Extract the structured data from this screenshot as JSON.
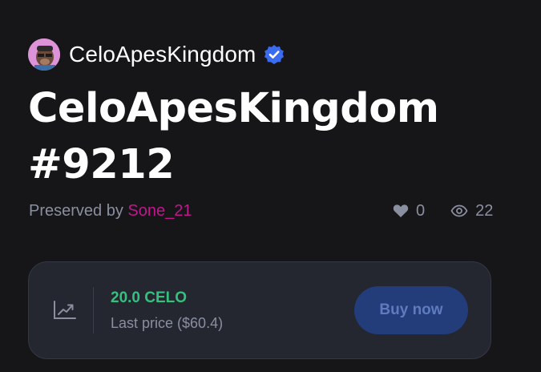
{
  "collection": {
    "name": "CeloApesKingdom",
    "verified_icon": "verified-badge-icon",
    "verified_color": "#3b6cf0"
  },
  "nft": {
    "title_line1": "CeloApesKingdom",
    "title_line2": "#9212"
  },
  "owner": {
    "prefix": "Preserved by",
    "name": "Sone_21",
    "name_color": "#c0178d"
  },
  "stats": {
    "likes": "0",
    "views": "22",
    "likes_icon": "heart-icon",
    "views_icon": "eye-icon"
  },
  "price": {
    "value": "20.0 CELO",
    "value_color": "#33c27d",
    "last_price": "Last price ($60.4)",
    "icon": "trending-up-icon"
  },
  "actions": {
    "buy_label": "Buy now"
  }
}
